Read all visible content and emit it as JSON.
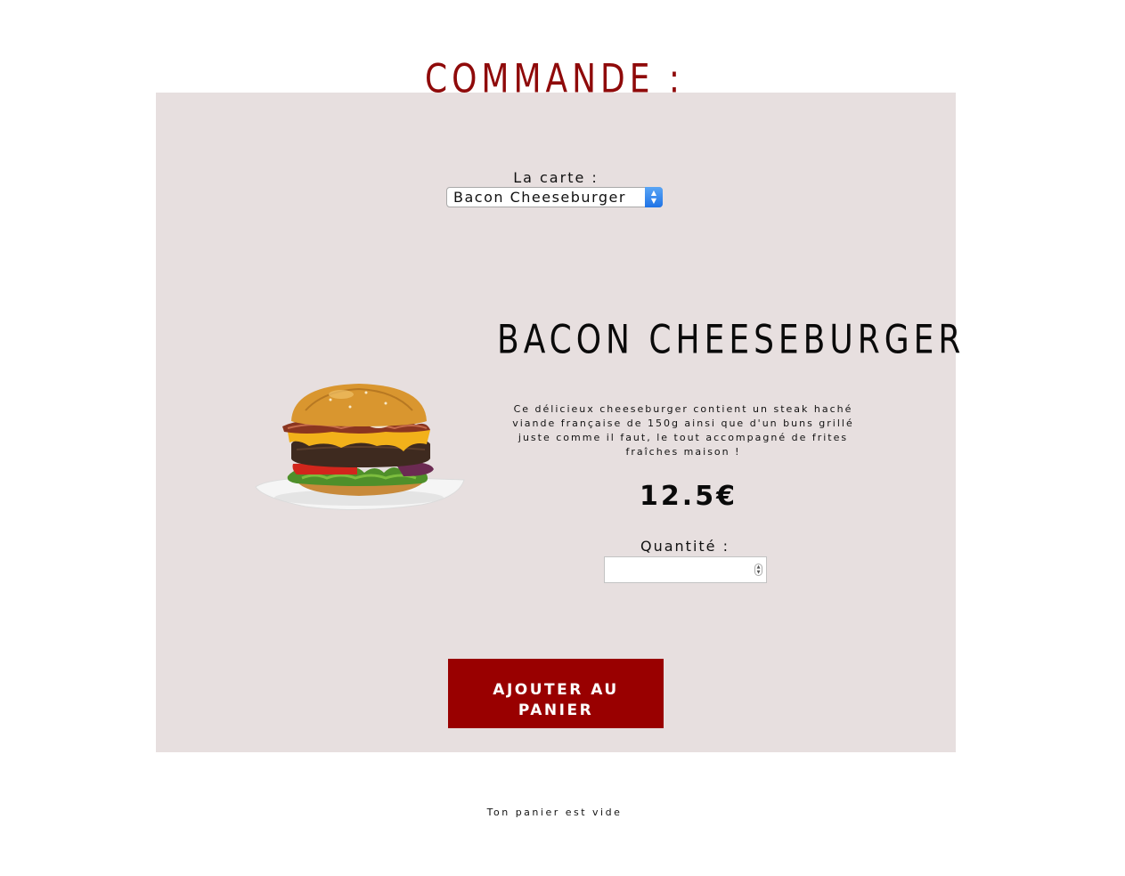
{
  "header": {
    "title": "COMMANDE :"
  },
  "menu": {
    "label": "La carte :",
    "selected": "Bacon Cheeseburger"
  },
  "product": {
    "name": "BACON CHEESEBURGER",
    "description": "Ce délicieux cheeseburger contient un steak haché viande française de 150g ainsi que d'un buns grillé juste comme il faut, le tout accompagné de frites fraîches maison !",
    "price": "12.5€",
    "image_icon": "bacon-cheeseburger-image"
  },
  "quantity": {
    "label": "Quantité :",
    "value": ""
  },
  "actions": {
    "add_to_cart": "AJOUTER AU PANIER"
  },
  "cart": {
    "status": "Ton panier est vide"
  },
  "colors": {
    "accent": "#990000",
    "title": "#8f0a0a",
    "panel_background": "#e7dfdf"
  }
}
